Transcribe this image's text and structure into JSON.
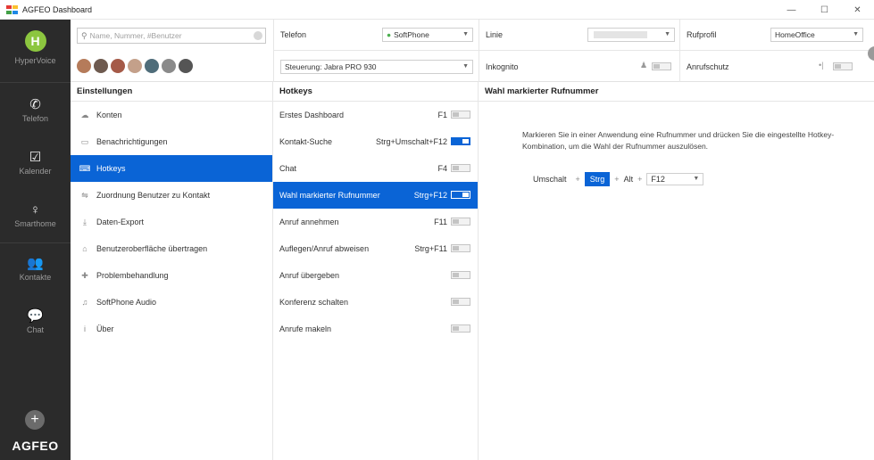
{
  "window": {
    "title": "AGFEO Dashboard",
    "minimize": "—",
    "maximize": "☐",
    "close": "✕"
  },
  "rail": {
    "avatar_letter": "H",
    "profile_label": "HyperVoice",
    "items": [
      {
        "label": "Telefon",
        "icon": "phone-icon",
        "glyph": "✆"
      },
      {
        "label": "Kalender",
        "icon": "calendar-icon",
        "glyph": "☑"
      },
      {
        "label": "Smarthome",
        "icon": "smarthome-icon",
        "glyph": "♀"
      },
      {
        "label": "Kontakte",
        "icon": "contacts-icon",
        "glyph": "👥"
      },
      {
        "label": "Chat",
        "icon": "chat-icon",
        "glyph": "💬"
      }
    ],
    "add_glyph": "+",
    "brand": "AGFEO"
  },
  "header": {
    "search_placeholder": "Name, Nummer, #Benutzer",
    "telefon_label": "Telefon",
    "telefon_value": "SoftPhone",
    "steuerung_value": "Steuerung: Jabra PRO 930",
    "linie_label": "Linie",
    "rufprofil_label": "Rufprofil",
    "rufprofil_value": "HomeOffice",
    "inkognito_label": "Inkognito",
    "anrufschutz_label": "Anrufschutz"
  },
  "settings": {
    "title": "Einstellungen",
    "items": [
      {
        "label": "Konten",
        "glyph": "☁"
      },
      {
        "label": "Benachrichtigungen",
        "glyph": "▭"
      },
      {
        "label": "Hotkeys",
        "glyph": "⌨"
      },
      {
        "label": "Zuordnung Benutzer zu Kontakt",
        "glyph": "⇋"
      },
      {
        "label": "Daten-Export",
        "glyph": "⤓"
      },
      {
        "label": "Benutzeroberfläche übertragen",
        "glyph": "⌂"
      },
      {
        "label": "Problembehandlung",
        "glyph": "✚"
      },
      {
        "label": "SoftPhone Audio",
        "glyph": "♫"
      },
      {
        "label": "Über",
        "glyph": "i"
      }
    ]
  },
  "hotkeys": {
    "title": "Hotkeys",
    "rows": [
      {
        "label": "Erstes Dashboard",
        "key": "F1",
        "on": false
      },
      {
        "label": "Kontakt-Suche",
        "key": "Strg+Umschalt+F12",
        "on": true
      },
      {
        "label": "Chat",
        "key": "F4",
        "on": false
      },
      {
        "label": "Wahl markierter Rufnummer",
        "key": "Strg+F12",
        "on": true
      },
      {
        "label": "Anruf annehmen",
        "key": "F11",
        "on": false
      },
      {
        "label": "Auflegen/Anruf abweisen",
        "key": "Strg+F11",
        "on": false
      },
      {
        "label": "Anruf übergeben",
        "key": "",
        "on": false
      },
      {
        "label": "Konferenz schalten",
        "key": "",
        "on": false
      },
      {
        "label": "Anrufe makeln",
        "key": "",
        "on": false
      }
    ]
  },
  "detail": {
    "title": "Wahl markierter Rufnummer",
    "description": "Markieren Sie in einer Anwendung eine Rufnummer und drücken Sie die eingestellte Hotkey-Kombination, um die Wahl der Rufnummer auszulösen.",
    "modifiers": [
      "Umschalt",
      "Strg",
      "Alt"
    ],
    "key_value": "F12",
    "plus": "+"
  },
  "colors": {
    "accent": "#0a64d6",
    "rail": "#2b2b2b",
    "brand_green": "#8cc63f"
  }
}
